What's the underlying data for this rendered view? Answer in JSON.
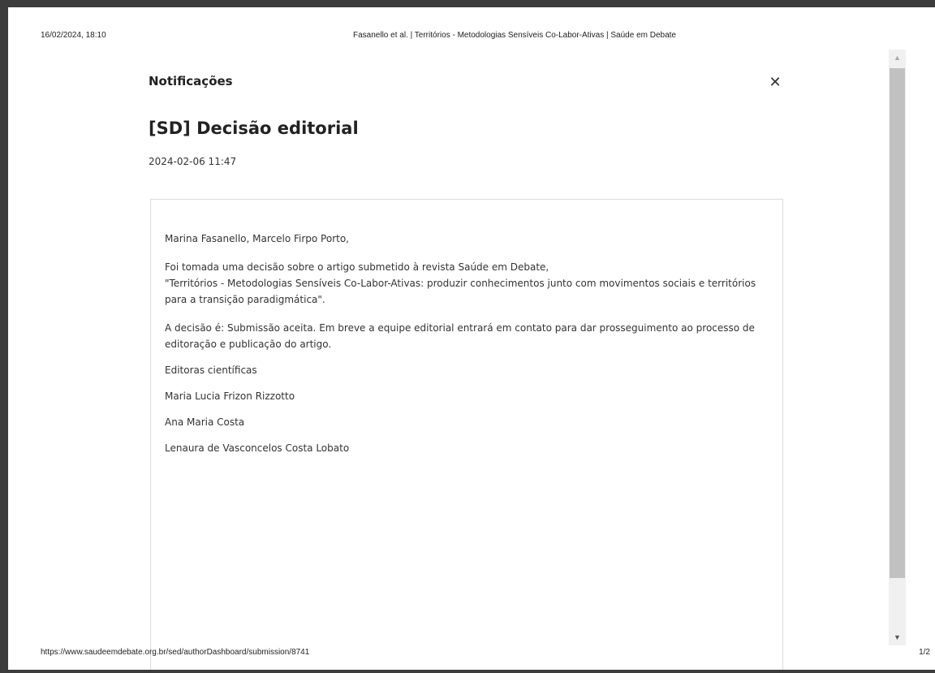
{
  "print_header": {
    "date": "16/02/2024, 18:10",
    "title": "Fasanello et al. | Territórios - Metodologias Sensíveis Co-Labor-Ativas | Saúde em Debate"
  },
  "print_footer": {
    "url": "https://www.saudeemdebate.org.br/sed/authorDashboard/submission/8741",
    "page": "1/2"
  },
  "modal": {
    "heading": "Notificações",
    "close_icon": "close-icon"
  },
  "notification": {
    "title": "[SD] Decisão editorial",
    "date": "2024-02-06 11:47",
    "greeting": "Marina Fasanello, Marcelo Firpo Porto,",
    "para1_line1": "Foi tomada uma decisão sobre o artigo submetido à revista Saúde em Debate,",
    "para1_line2": "\"Territórios - Metodologias Sensíveis Co-Labor-Ativas: produzir conhecimentos junto com movimentos sociais e territórios para a transição paradigmática\".",
    "para2": "A decisão é: Submissão aceita. Em breve a equipe editorial entrará em contato para dar prosseguimento ao processo de editoração e publicação do artigo.",
    "signature_title": "Editoras científicas",
    "editors": [
      "Maria Lucia Frizon Rizzotto",
      "Ana Maria Costa",
      "Lenaura de Vasconcelos Costa Lobato"
    ]
  },
  "scrollbar": {
    "up_icon": "arrow-up-icon",
    "down_icon": "arrow-down-icon"
  }
}
